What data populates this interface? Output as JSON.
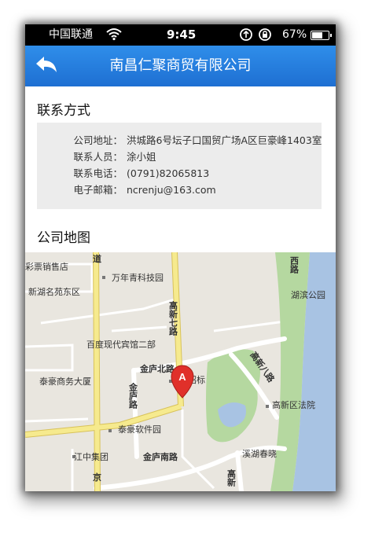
{
  "status_bar": {
    "carrier": "中国联通",
    "time": "9:45",
    "battery_percent": "67%",
    "battery_level": 0.67,
    "icons": [
      "signal-icon",
      "wifi-icon",
      "sync-icon",
      "orientation-lock-icon",
      "battery-icon"
    ]
  },
  "navbar": {
    "title": "南昌仁聚商贸有限公司",
    "back_icon": "back-arrow-icon"
  },
  "contact": {
    "heading": "联系方式",
    "rows": [
      {
        "label": "公司地址：",
        "value": "洪城路6号坛子口国贸广场A区巨豪峰1403室"
      },
      {
        "label": "联系人员：",
        "value": "涂小姐"
      },
      {
        "label": "联系电话：",
        "value": "(0791)82065813"
      },
      {
        "label": "电子邮箱：",
        "value": "ncrenju@163.com"
      }
    ]
  },
  "map_section": {
    "heading": "公司地图",
    "marker_label": "A",
    "pois": [
      "彩票销售店",
      "万年青科技园",
      "新湖名苑东区",
      "湖滨公园",
      "百度现代宾馆二部",
      "泰豪商务大厦",
      "政招标",
      "高新区法院",
      "泰豪软件园",
      "江中集团",
      "溪湖春晓"
    ],
    "roads": [
      "道",
      "高新七路",
      "金庐北路",
      "金庐路",
      "高新八路",
      "金庐南路",
      "西路",
      "京",
      "高新"
    ]
  },
  "colors": {
    "navbar": "#1e6fd2",
    "map_land": "#e9e6df",
    "map_water": "#a8c3e3",
    "map_park": "#b5d8a0",
    "road_major": "#f3e27a",
    "marker": "#e0302a"
  }
}
